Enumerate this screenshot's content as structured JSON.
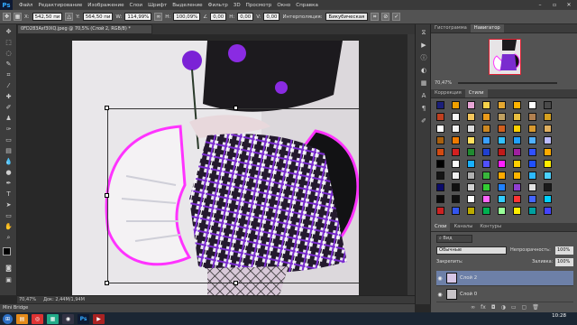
{
  "app": {
    "logo": "Ps"
  },
  "menu": [
    "Файл",
    "Редактирование",
    "Изображение",
    "Слои",
    "Шрифт",
    "Выделение",
    "Фильтр",
    "3D",
    "Просмотр",
    "Окно",
    "Справка"
  ],
  "options": {
    "x_label": "X:",
    "x_value": "542,50 пи",
    "y_label": "Y:",
    "y_value": "564,50 пи",
    "w_label": "W:",
    "w_value": "114,99%",
    "h_label": "H:",
    "h_value": "100,09%",
    "angle_value": "0,00",
    "h2_label": "H:",
    "h2_value": "0,00",
    "v_label": "V:",
    "v_value": "0,00",
    "interp_label": "Интерполяция:",
    "interp_value": "Бикубическая"
  },
  "document": {
    "tab": "0FD283Asf3IXQ.jpeg @ 70,5% (Слой 2, RGB/8) *"
  },
  "status": {
    "zoom": "70,47%",
    "doc": "Док: 2,44М/1,94М"
  },
  "bridge": {
    "label": "Mini Bridge"
  },
  "panels": {
    "top_tabs": [
      "Гистограмма",
      "Навигатор"
    ],
    "nav_zoom": "70,47%",
    "mid_tabs": [
      "Коррекция",
      "Стили"
    ],
    "layer_tabs": [
      "Слои",
      "Каналы",
      "Контуры"
    ],
    "kind_label": "Вид",
    "blend_mode": "Обычные",
    "opacity_label": "Непрозрачность:",
    "opacity_value": "100%",
    "lock_label": "Закрепить:",
    "fill_label": "Заливка:",
    "fill_value": "100%",
    "layers": [
      {
        "name": "Слой 2",
        "selected": true
      },
      {
        "name": "Слой 0",
        "selected": false
      }
    ]
  },
  "taskbar": {
    "time": "10:28"
  },
  "colors": {
    "accent": "#31a8ff",
    "selected_layer": "#6d80a8",
    "swatches": [
      "#1b1f7a",
      "#f0a000",
      "#e8a5d6",
      "#f6d24a",
      "#e6a830",
      "#ffb300",
      "#ffffff",
      "#4a4a4a",
      "#c04020",
      "#f6f6f6",
      "#f4c65c",
      "#e89a1b",
      "#c0a060",
      "#e8be40",
      "#b08050",
      "#d4a020",
      "#ffffff",
      "#f1f1f1",
      "#dcdcdc",
      "#cc8822",
      "#d06020",
      "#ffd000",
      "#d89a30",
      "#e0b060",
      "#a86010",
      "#ee7a00",
      "#ffe060",
      "#3aa0ff",
      "#33c0ff",
      "#20a0ff",
      "#50b0ff",
      "#bbbbff",
      "#d24a12",
      "#d42020",
      "#1f8a30",
      "#2040d0",
      "#c01a1a",
      "#a020a0",
      "#3050ff",
      "#ffaa00",
      "#000000",
      "#fafafa",
      "#18b0ff",
      "#5050ff",
      "#ff20ff",
      "#ffd000",
      "#2050ff",
      "#ffee00",
      "#151515",
      "#f0f0f0",
      "#b0b0b0",
      "#39b63c",
      "#ffaa00",
      "#ffb400",
      "#2db9ff",
      "#4bd1ff",
      "#0a0a6a",
      "#101010",
      "#d1d1d1",
      "#33cc33",
      "#2080ff",
      "#8f3fd0",
      "#e3e3e3",
      "#1a1a1a",
      "#0b0b0b",
      "#101010",
      "#ffffff",
      "#ff66ff",
      "#33ccff",
      "#ff3333",
      "#4466ff",
      "#00d0ff",
      "#cc2222",
      "#3355ee",
      "#bbaa00",
      "#00b050",
      "#99ff99",
      "#ffee00",
      "#00a0a0",
      "#4444ff"
    ]
  }
}
